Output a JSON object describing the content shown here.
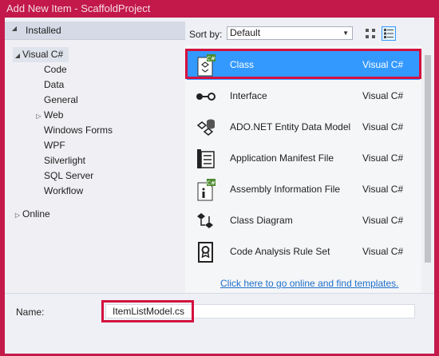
{
  "window": {
    "title": "Add New Item - ScaffoldProject"
  },
  "tree": {
    "installed": "Installed",
    "root": "Visual C#",
    "children": [
      "Code",
      "Data",
      "General",
      "Web",
      "Windows Forms",
      "WPF",
      "Silverlight",
      "SQL Server",
      "Workflow"
    ],
    "online": "Online"
  },
  "sort": {
    "label": "Sort by:",
    "value": "Default"
  },
  "items": [
    {
      "name": "Class",
      "lang": "Visual C#",
      "icon": "class-icon"
    },
    {
      "name": "Interface",
      "lang": "Visual C#",
      "icon": "interface-icon"
    },
    {
      "name": "ADO.NET Entity Data Model",
      "lang": "Visual C#",
      "icon": "entity-model-icon"
    },
    {
      "name": "Application Manifest File",
      "lang": "Visual C#",
      "icon": "manifest-icon"
    },
    {
      "name": "Assembly Information File",
      "lang": "Visual C#",
      "icon": "assembly-info-icon"
    },
    {
      "name": "Class Diagram",
      "lang": "Visual C#",
      "icon": "class-diagram-icon"
    },
    {
      "name": "Code Analysis Rule Set",
      "lang": "Visual C#",
      "icon": "rule-set-icon"
    }
  ],
  "online_link": "Click here to go online and find templates.",
  "name_field": {
    "label": "Name:",
    "value": "ItemListModel.cs"
  },
  "colors": {
    "accent": "#3399ff",
    "highlight": "#d4113f",
    "titlebar": "#c2184a"
  }
}
